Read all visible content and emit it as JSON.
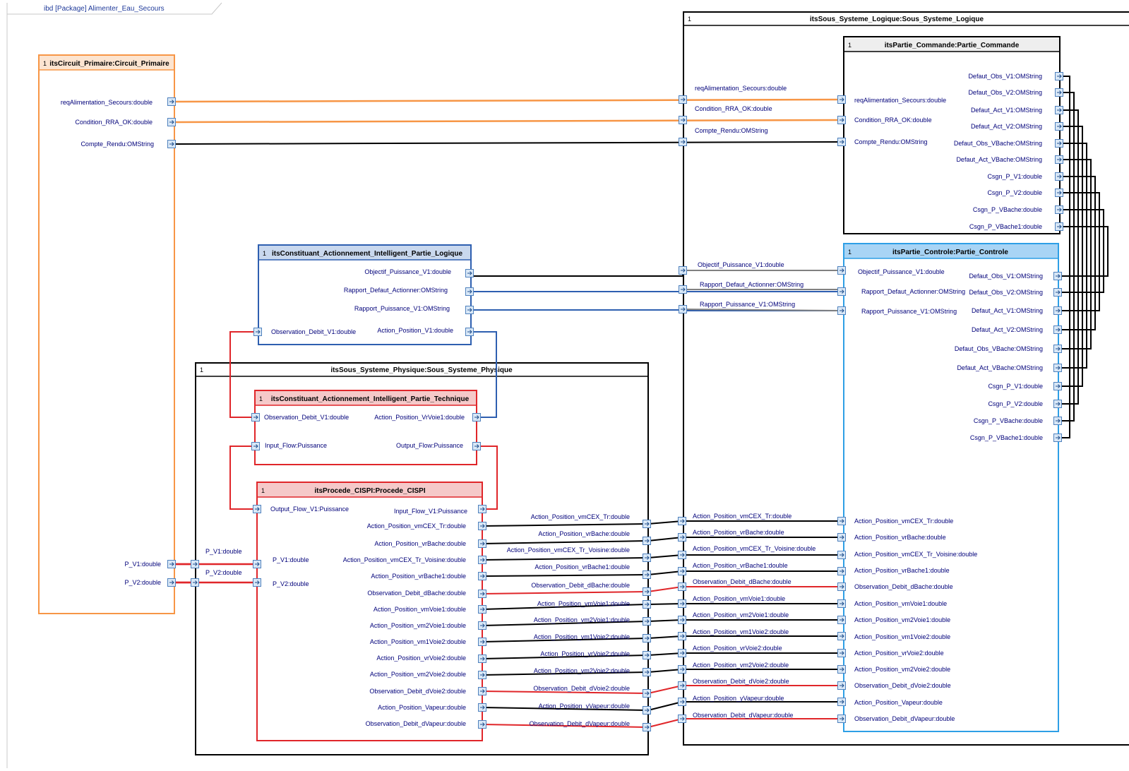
{
  "diagram_tab": "ibd [Package] Alimenter_Eau_Secours",
  "colors": {
    "orange": "#f79646",
    "blue": "#2e5fb0",
    "red": "#e0262a",
    "light_blue": "#2e9fe6",
    "gray": "#808080",
    "black": "#000000",
    "port_fill": "#d9e8f7",
    "port_stroke": "#4f81bd"
  },
  "blocks": {
    "circuit_primaire": {
      "mult": "1",
      "title": "itsCircuit_Primaire:Circuit_Primaire"
    },
    "sous_systeme_logique": {
      "mult": "1",
      "title": "itsSous_Systeme_Logique:Sous_Systeme_Logique"
    },
    "partie_commande": {
      "mult": "1",
      "title": "itsPartie_Commande:Partie_Commande"
    },
    "partie_controle": {
      "mult": "1",
      "title": "itsPartie_Controle:Partie_Controle"
    },
    "ca_logique": {
      "mult": "1",
      "title": "itsConstituant_Actionnement_Intelligent_Partie_Logique"
    },
    "sous_systeme_physique": {
      "mult": "1",
      "title": "itsSous_Systeme_Physique:Sous_Systeme_Physique"
    },
    "ca_technique": {
      "mult": "1",
      "title": "itsConstituant_Actionnement_Intelligent_Partie_Technique"
    },
    "procede": {
      "mult": "1",
      "title": "itsProcede_CISPI:Procede_CISPI"
    }
  },
  "labels": [
    "reqAlimentation_Secours:double",
    "Condition_RRA_OK:double",
    "Compte_Rendu:OMString",
    "P_V1:double",
    "P_V2:double",
    "reqAlimentation_Secours:double",
    "Condition_RRA_OK:double",
    "Compte_Rendu:OMString",
    "Objectif_Puissance_V1:double",
    "Rapport_Defaut_Actionner:OMString",
    "Rapport_Puissance_V1:OMString",
    "reqAlimentation_Secours:double",
    "Condition_RRA_OK:double",
    "Compte_Rendu:OMString",
    "Defaut_Obs_V1:OMString",
    "Defaut_Obs_V2:OMString",
    "Defaut_Act_V1:OMString",
    "Defaut_Act_V2:OMString",
    "Defaut_Obs_VBache:OMString",
    "Defaut_Act_VBache:OMString",
    "Csgn_P_V1:double",
    "Csgn_P_V2:double",
    "Csgn_P_VBache:double",
    "Csgn_P_VBache1:double",
    "Objectif_Puissance_V1:double",
    "Rapport_Defaut_Actionner:OMString",
    "Rapport_Puissance_V1:OMString",
    "Csgn_P_VBache1:double",
    "Csgn_P_VBache:double",
    "Csgn_P_V2:double",
    "Csgn_P_V1:double",
    "Defaut_Act_VBache:OMString",
    "Defaut_Obs_VBache:OMString",
    "Defaut_Act_V2:OMString",
    "Defaut_Act_V1:OMString",
    "Defaut_Obs_V2:OMString",
    "Defaut_Obs_V1:OMString",
    "Objectif_Puissance_V1:double",
    "Rapport_Defaut_Actionner:OMString",
    "Rapport_Puissance_V1:OMString",
    "Observation_Debit_V1:double",
    "Action_Position_V1:double",
    "Observation_Debit_V1:double",
    "Action_Position_VrVoie1:double",
    "Input_Flow:Puissance",
    "Output_Flow:Puissance",
    "Output_Flow_V1:Puissance",
    "Input_Flow_V1:Puissance",
    "Action_Position_vmCEX_Tr:double",
    "Action_Position_vrBache:double",
    "Action_Position_vmCEX_Tr_Voisine:double",
    "Action_Position_vrBache1:double",
    "Observation_Debit_dBache:double",
    "Action_Position_vmVoie1:double",
    "Action_Position_vm2Voie1:double",
    "Action_Position_vm1Voie2:double",
    "Action_Position_vrVoie2:double",
    "Action_Position_vm2Voie2:double",
    "Observation_Debit_dVoie2:double",
    "Action_Position_Vapeur:double",
    "Observation_Debit_dVapeur:double",
    "P_V1:double",
    "P_V2:double",
    "P_V1:double",
    "P_V2:double",
    "Action_Position_vmCEX_Tr:double",
    "Action_Position_vrBache:double",
    "Action_Position_vmCEX_Tr_Voisine:double",
    "Action_Position_vrBache1:double",
    "Observation_Debit_dBache:double",
    "Action_Position_vmVoie1:double",
    "Action_Position_vm2Voie1:double",
    "Action_Position_vm1Voie2:double",
    "Action_Position_vrVoie2:double",
    "Action_Position_vm2Voie2:double",
    "Observation_Debit_dVoie2:double",
    "Action_Position_yVapeur:double",
    "Observation_Debit_dVapeur:double",
    "Action_Position_vmCEX_Tr:double",
    "Action_Position_vrBache:double",
    "Action_Position_vmCEX_Tr_Voisine:double",
    "Action_Position_vrBache1:double",
    "Observation_Debit_dBache:double",
    "Action_Position_vmVoie1:double",
    "Action_Position_vm2Voie1:double",
    "Action_Position_vm1Voie2:double",
    "Action_Position_vrVoie2:double",
    "Action_Position_vm2Voie2:double",
    "Observation_Debit_dVoie2:double",
    "Action_Position_yVapeur:double",
    "Observation_Debit_dVapeur:double",
    "Action_Position_vmCEX_Tr:double",
    "Action_Position_vrBache:double",
    "Action_Position_vmCEX_Tr_Voisine:double",
    "Action_Position_vrBache1:double",
    "Observation_Debit_dBache:double",
    "Action_Position_vmVoie1:double",
    "Action_Position_vm2Voie1:double",
    "Action_Position_vm1Voie2:double",
    "Action_Position_vrVoie2:double",
    "Action_Position_vm2Voie2:double",
    "Observation_Debit_dVoie2:double",
    "Action_Position_Vapeur:double",
    "Observation_Debit_dVapeur:double"
  ]
}
